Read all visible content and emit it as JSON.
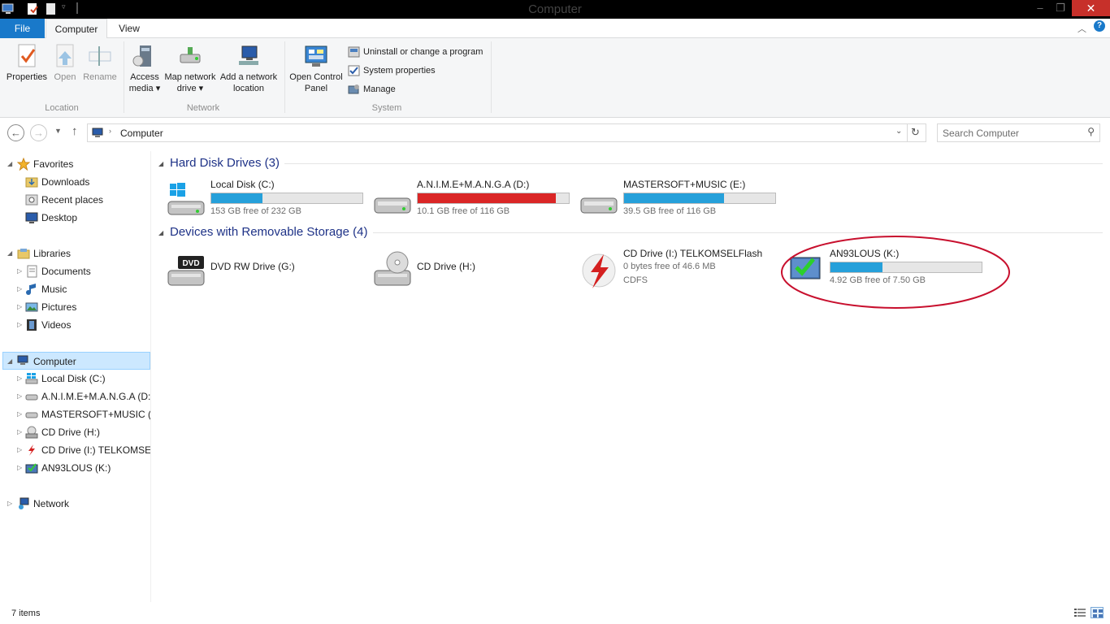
{
  "window": {
    "title": "Computer",
    "controls": {
      "minimize": "–",
      "maximize": "❐",
      "close": "✕"
    }
  },
  "ribbon_tabs": {
    "file": "File",
    "computer": "Computer",
    "view": "View"
  },
  "ribbon": {
    "location": {
      "properties": "Properties",
      "open": "Open",
      "rename": "Rename",
      "label": "Location"
    },
    "network": {
      "access_media": [
        "Access",
        "media ▾"
      ],
      "map_drive": [
        "Map network",
        "drive ▾"
      ],
      "add_location": [
        "Add a network",
        "location"
      ],
      "label": "Network"
    },
    "system": {
      "control_panel": [
        "Open Control",
        "Panel"
      ],
      "uninstall": "Uninstall or change a program",
      "properties": "System properties",
      "manage": "Manage",
      "label": "System"
    }
  },
  "address": {
    "crumb": "Computer",
    "search_placeholder": "Search Computer"
  },
  "nav": {
    "favorites": "Favorites",
    "downloads": "Downloads",
    "recent": "Recent places",
    "desktop": "Desktop",
    "libraries": "Libraries",
    "documents": "Documents",
    "music": "Music",
    "pictures": "Pictures",
    "videos": "Videos",
    "computer": "Computer",
    "drive_c": "Local Disk (C:)",
    "drive_d": "A.N.I.M.E+M.A.N.G.A (D:)",
    "drive_e": "MASTERSOFT+MUSIC (E:)",
    "drive_h": "CD Drive (H:)",
    "drive_i": "CD Drive (I:) TELKOMSELFlash",
    "drive_k": "AN93LOUS (K:)",
    "network": "Network"
  },
  "content": {
    "hard_disks_header": "Hard Disk Drives (3)",
    "removable_header": "Devices with Removable Storage (4)",
    "drive_c": {
      "name": "Local Disk (C:)",
      "free": "153 GB free of 232 GB",
      "used_fraction": 0.34
    },
    "drive_d": {
      "name": "A.N.I.M.E+M.A.N.G.A (D:)",
      "free": "10.1 GB free of 116 GB",
      "used_fraction": 0.913
    },
    "drive_e": {
      "name": "MASTERSOFT+MUSIC (E:)",
      "free": "39.5 GB free of 116 GB",
      "used_fraction": 0.66
    },
    "drive_g": {
      "name": "DVD RW Drive (G:)",
      "icon_text": "DVD"
    },
    "drive_h": {
      "name": "CD Drive (H:)"
    },
    "drive_i": {
      "name": "CD Drive (I:) TELKOMSELFlash",
      "free": "0 bytes free of 46.6 MB",
      "fs": "CDFS"
    },
    "drive_k": {
      "name": "AN93LOUS (K:)",
      "free": "4.92 GB free of 7.50 GB",
      "used_fraction": 0.344
    }
  },
  "status": {
    "count": "7 items"
  },
  "colors": {
    "accent": "#1979ca",
    "bar_normal": "#26a0da",
    "bar_full": "#da2626",
    "annotation": "#c8102e"
  }
}
